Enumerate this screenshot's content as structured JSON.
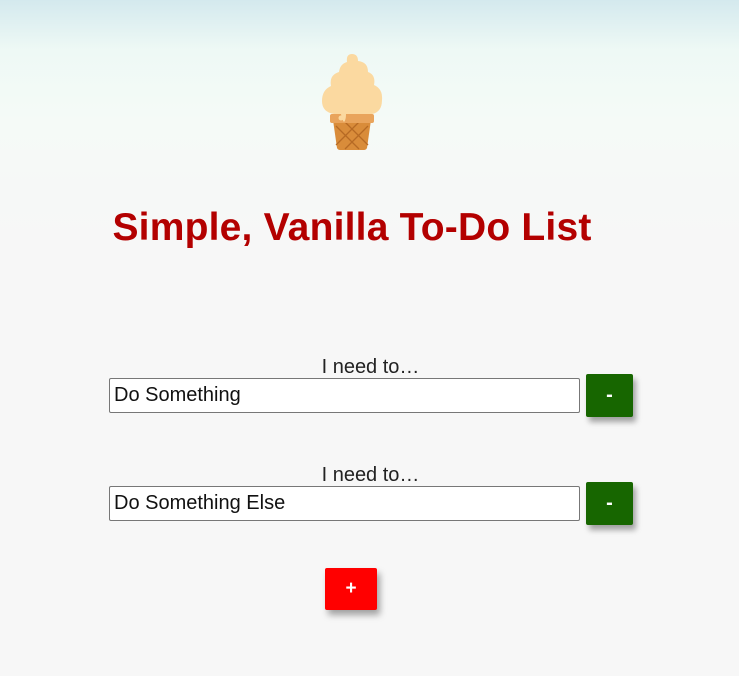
{
  "header": {
    "logo_icon": "soft-serve-ice-cream-cone-icon",
    "title": "Simple, Vanilla To-Do List"
  },
  "todos": [
    {
      "label": "I need to…",
      "value": "Do Something",
      "remove_label": "-"
    },
    {
      "label": "I need to…",
      "value": "Do Something Else",
      "remove_label": "-"
    }
  ],
  "add_button": {
    "label": "+"
  },
  "colors": {
    "title": "#b30000",
    "remove_button": "#176600",
    "add_button": "#ff0000",
    "background": "#f7f7f7"
  }
}
